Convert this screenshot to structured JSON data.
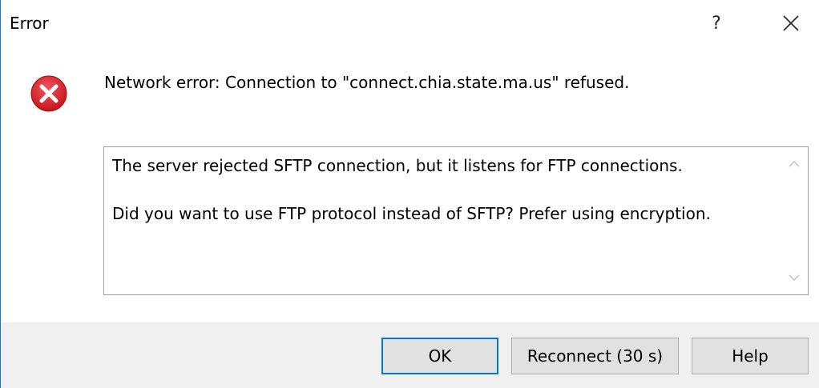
{
  "window": {
    "title": "Error",
    "help_label": "?",
    "close_icon": "close-icon",
    "border_color": "#1979ca"
  },
  "error": {
    "icon": "error-icon",
    "icon_color": "#e81123",
    "message": "Network error: Connection to \"connect.chia.state.ma.us\" refused."
  },
  "details": {
    "lines": [
      "The server rejected SFTP connection, but it listens for FTP connections.",
      "Did you want to use FTP protocol instead of SFTP? Prefer using encryption."
    ]
  },
  "buttons": {
    "ok_label": "OK",
    "reconnect_label": "Reconnect (30 s)",
    "help_label": "Help",
    "default_border_color": "#0078d7"
  }
}
